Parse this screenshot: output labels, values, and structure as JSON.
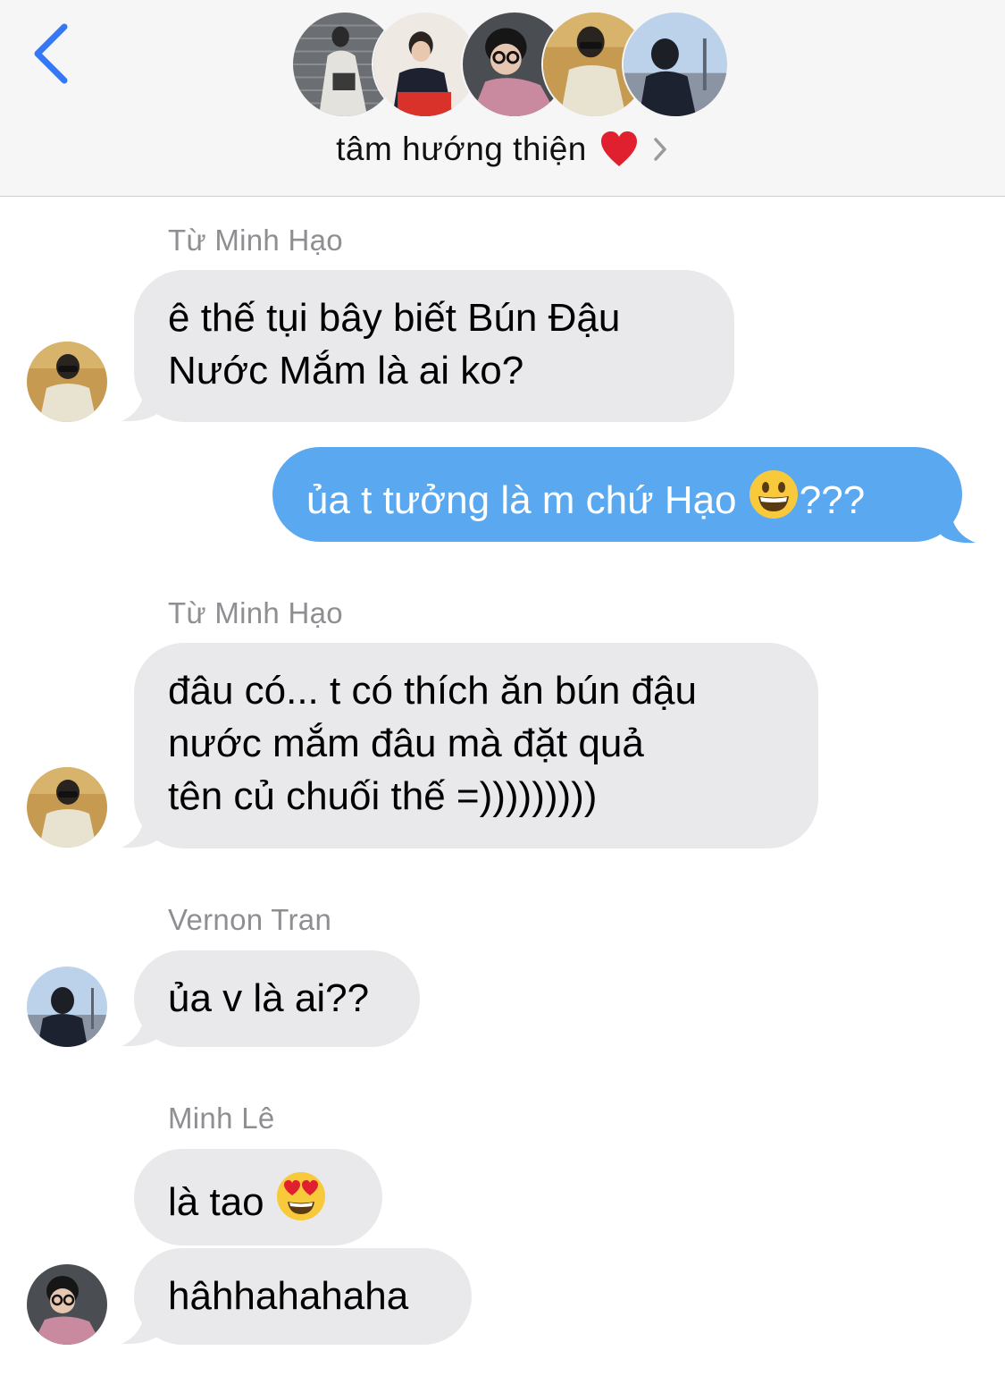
{
  "header": {
    "back_icon": "chevron-left-icon",
    "group_name": "tâm hướng thiện",
    "heart_icon": "red-heart-icon",
    "disclosure_icon": "chevron-right-icon",
    "accent_color": "#3478f6",
    "group_avatars": [
      "member-photo-1",
      "member-photo-2",
      "member-photo-3",
      "member-photo-4",
      "member-photo-5"
    ]
  },
  "messages": [
    {
      "sender": "Từ Minh Hạo",
      "lines": [
        "ê thế tụi bây biết Bún Đậu",
        "Nước Mắm là ai ko?"
      ],
      "outgoing": false
    },
    {
      "text_before": "ủa t tưởng là m chứ Hạo ",
      "emoji": "grinning-face-emoji",
      "text_after": "???",
      "outgoing": true
    },
    {
      "sender": "Từ Minh Hạo",
      "lines": [
        "đâu có... t có thích ăn bún đậu",
        "nước mắm đâu mà đặt quả",
        "tên củ chuối thế =)))))))))"
      ],
      "outgoing": false
    },
    {
      "sender": "Vernon Tran",
      "text": "ủa v là ai??",
      "outgoing": false
    },
    {
      "sender": "Minh Lê",
      "text_before": "là tao ",
      "emoji": "heart-eyes-emoji",
      "outgoing": false
    },
    {
      "text": "hâhhahahaha",
      "outgoing": false
    }
  ],
  "colors": {
    "incoming_bubble": "#e9e9eb",
    "outgoing_bubble": "#5aa9f0",
    "sender_label": "#8e8e93"
  }
}
